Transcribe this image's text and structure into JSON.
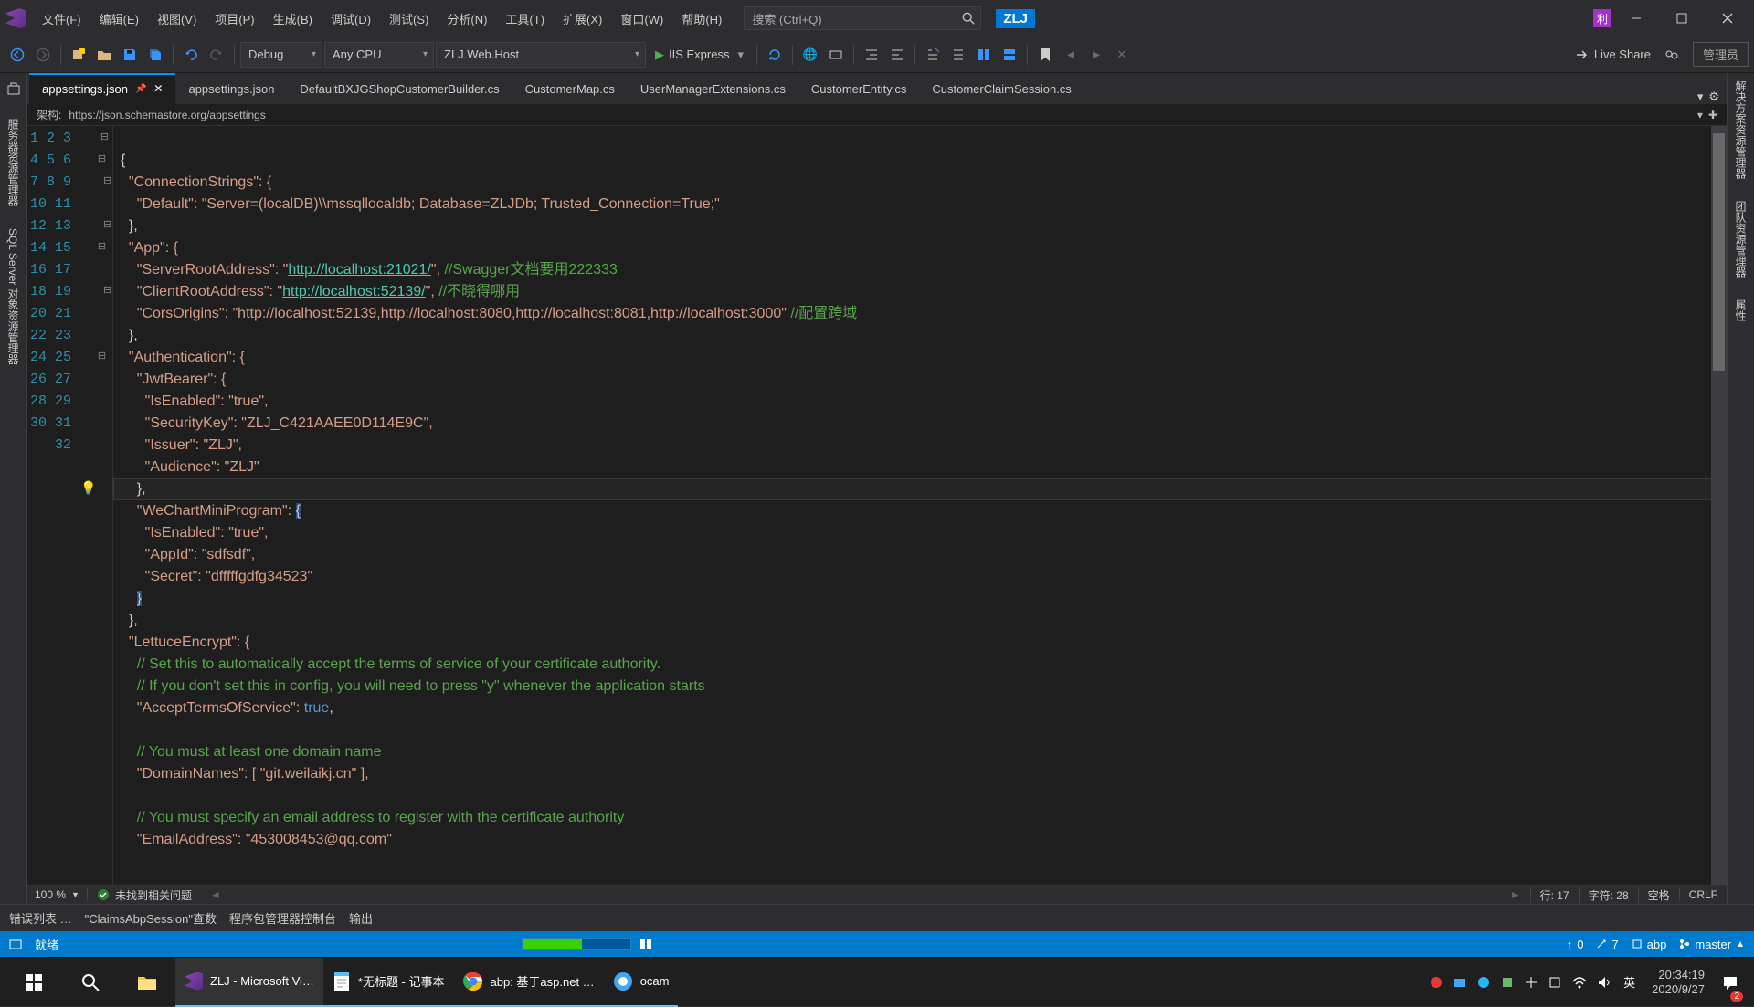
{
  "menu": {
    "file": "文件(F)",
    "edit": "编辑(E)",
    "view": "视图(V)",
    "project": "项目(P)",
    "build": "生成(B)",
    "debug": "调试(D)",
    "test": "测试(S)",
    "analyze": "分析(N)",
    "tools": "工具(T)",
    "extensions": "扩展(X)",
    "window": "窗口(W)",
    "help": "帮助(H)"
  },
  "search_placeholder": "搜索 (Ctrl+Q)",
  "solution_title": "ZLJ",
  "vip_badge": "利",
  "toolbar": {
    "config": "Debug",
    "platform": "Any CPU",
    "startup": "ZLJ.Web.Host",
    "run": "IIS Express",
    "live_share": "Live Share",
    "admin": "管理员"
  },
  "tabs": [
    {
      "label": "appsettings.json",
      "active": true,
      "pinned": true,
      "closable": true
    },
    {
      "label": "appsettings.json"
    },
    {
      "label": "DefaultBXJGShopCustomerBuilder.cs"
    },
    {
      "label": "CustomerMap.cs"
    },
    {
      "label": "UserManagerExtensions.cs"
    },
    {
      "label": "CustomerEntity.cs"
    },
    {
      "label": "CustomerClaimSession.cs"
    }
  ],
  "schema_label": "架构:",
  "schema_url": "https://json.schemastore.org/appsettings",
  "code": {
    "serverRootUrl": "http://localhost:21021/",
    "clientRootUrl": "http://localhost:52139/",
    "swaggerComment": "//Swagger文档要用222333",
    "clientComment": "//不晓得哪用",
    "corsComment": "//配置跨域",
    "c1": "// Set this to automatically accept the terms of service of your certificate authority.",
    "c2": "// If you don't set this in config, you will need to press \"y\" whenever the application starts",
    "c3": "// You must at least one domain name",
    "c4": "// You must specify an email address to register with the certificate authority",
    "lines": {
      "l1": "{",
      "l2": "  \"ConnectionStrings\": {",
      "l3": "    \"Default\": \"Server=(localDB)\\\\mssqllocaldb; Database=ZLJDb; Trusted_Connection=True;\"",
      "l4": "  },",
      "l5": "  \"App\": {",
      "l8": "    \"CorsOrigins\": \"http://localhost:52139,http://localhost:8080,http://localhost:8081,http://localhost:3000\"",
      "l9": "  },",
      "l10": "  \"Authentication\": {",
      "l11": "    \"JwtBearer\": {",
      "l12": "      \"IsEnabled\": \"true\",",
      "l13": "      \"SecurityKey\": \"ZLJ_C421AAEE0D114E9C\",",
      "l14": "      \"Issuer\": \"ZLJ\",",
      "l15": "      \"Audience\": \"ZLJ\"",
      "l16": "    },",
      "l17p": "    \"WeChartMiniProgram\": ",
      "l18": "      \"IsEnabled\": \"true\",",
      "l19": "      \"AppId\": \"sdfsdf\",",
      "l20": "      \"Secret\": \"dfffffgdfg34523\"",
      "l22": "  },",
      "l23": "  \"LettuceEncrypt\": {",
      "l29": "    \"DomainNames\": [ \"git.weilaikj.cn\" ],",
      "l32": "    \"EmailAddress\": \"453008453@qq.com\""
    }
  },
  "zoom": "100 %",
  "issues_text": "未找到相关问题",
  "caret": {
    "line": "行: 17",
    "col": "字符: 28",
    "ins": "空格",
    "eol": "CRLF"
  },
  "bottom_tabs": {
    "errors": "错误列表 …",
    "claims": "\"ClaimsAbpSession\"查数",
    "package": "程序包管理器控制台",
    "output": "输出"
  },
  "status": {
    "ready": "就绪",
    "up": "0",
    "pen": "7",
    "repo": "abp",
    "branch": "master"
  },
  "side_left": {
    "a": "服务器资源管理器",
    "b": "SQL Server 对象资源管理器"
  },
  "side_right": {
    "a": "解决方案资源管理器",
    "b": "团队资源管理器",
    "c": "属性"
  },
  "taskbar": {
    "vs": "ZLJ - Microsoft Vi…",
    "notepad": "*无标题 - 记事本",
    "chrome": "abp: 基于asp.net …",
    "ocam": "ocam",
    "ime": "英",
    "time": "20:34:19",
    "date": "2020/9/27",
    "notif": "2"
  }
}
